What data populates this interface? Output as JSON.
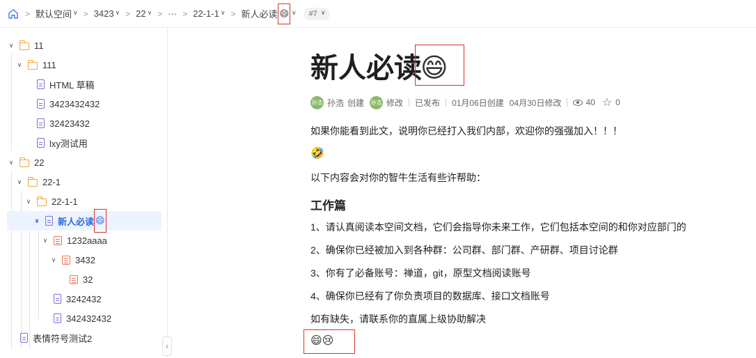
{
  "breadcrumb": {
    "items": [
      "默认空间",
      "3423",
      "22",
      "···",
      "22-1-1",
      "新人必读"
    ],
    "current_emoji": "😄",
    "version": "#7"
  },
  "sidebar": {
    "tree": [
      {
        "label": "11",
        "type": "folder",
        "expanded": true
      },
      {
        "label": "111",
        "type": "folder",
        "expanded": true
      },
      {
        "label": "HTML 草稿",
        "type": "doc"
      },
      {
        "label": "3423432432",
        "type": "doc"
      },
      {
        "label": "32423432",
        "type": "doc"
      },
      {
        "label": "lxy测试用",
        "type": "doc"
      },
      {
        "label": "22",
        "type": "folder",
        "expanded": true
      },
      {
        "label": "22-1",
        "type": "folder",
        "expanded": true
      },
      {
        "label": "22-1-1",
        "type": "folder",
        "expanded": true
      },
      {
        "label": "新人必读",
        "type": "doc",
        "emoji": "😄",
        "active": true,
        "expanded": true
      },
      {
        "label": "1232aaaa",
        "type": "table",
        "expanded": true
      },
      {
        "label": "3432",
        "type": "table",
        "expanded": true
      },
      {
        "label": "32",
        "type": "table"
      },
      {
        "label": "3242432",
        "type": "doc"
      },
      {
        "label": "342432432",
        "type": "doc"
      },
      {
        "label": "表情符号测试2",
        "type": "doc"
      }
    ],
    "collapse_glyph": "‹"
  },
  "doc": {
    "title": "新人必读",
    "title_emoji": "😄",
    "meta": {
      "author_avatar": "孙浩",
      "author": "孙浩",
      "created_label": "创建",
      "editor_avatar": "孙浩",
      "modified_label": "修改",
      "status": "已发布",
      "created_date": "01月06日创建",
      "modified_date": "04月30日修改",
      "views": "40",
      "stars": "0"
    },
    "paragraphs": [
      "如果你能看到此文，说明你已经打入我们内部，欢迎你的强强加入！！！",
      "🤣",
      "以下内容会对你的智牛生活有些许帮助："
    ],
    "section_heading": "工作篇",
    "items": [
      "1、请认真阅读本空间文档，它们会指导你未来工作，它们包括本空间的和你对应部门的",
      "2、确保你已经被加入到各种群：公司群、部门群、产研群、项目讨论群",
      "3、你有了必备账号：禅道，git，原型文档阅读账号",
      "4、确保你已经有了你负责项目的数据库、接口文档账号"
    ],
    "closing": "如有缺失，请联系你的直属上级协助解决",
    "emoji_line": "😄😢"
  }
}
